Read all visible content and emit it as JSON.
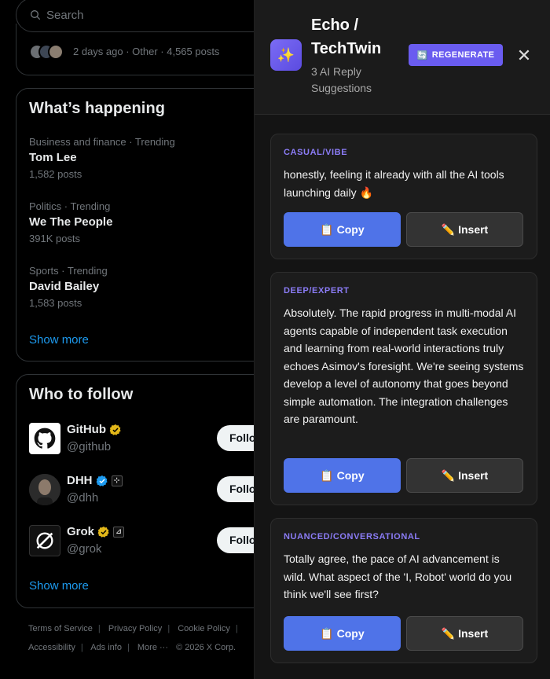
{
  "search": {
    "placeholder": "Search"
  },
  "news": {
    "meta": "2 days ago · Other · 4,565 posts"
  },
  "happening": {
    "title": "What’s happening",
    "trends": [
      {
        "context": "Business and finance · Trending",
        "name": "Tom Lee",
        "count": "1,582 posts"
      },
      {
        "context": "Politics · Trending",
        "name": "We The People",
        "count": "391K posts"
      },
      {
        "context": "Sports · Trending",
        "name": "David Bailey",
        "count": "1,583 posts"
      }
    ],
    "show_more": "Show more"
  },
  "who_to_follow": {
    "title": "Who to follow",
    "accounts": [
      {
        "name": "GitHub",
        "handle": "@github",
        "badge": "gold-check",
        "button": "Follow"
      },
      {
        "name": "DHH",
        "handle": "@dhh",
        "badge": "blue-check",
        "button": "Follow"
      },
      {
        "name": "Grok",
        "handle": "@grok",
        "badge": "gold-check",
        "button": "Follow"
      }
    ],
    "show_more": "Show more"
  },
  "footer": {
    "links_row1": [
      "Terms of Service",
      "Privacy Policy",
      "Cookie Policy"
    ],
    "links_row2": [
      "Accessibility",
      "Ads info",
      "More ···"
    ],
    "copyright": "© 2026 X Corp."
  },
  "panel": {
    "title": "Echo / TechTwin",
    "subtitle": "3 AI Reply Suggestions",
    "regenerate_label": "REGENERATE",
    "regenerate_icon": "🔄",
    "close_icon": "✕",
    "logo_icon": "✨",
    "accent": "#6a5cf0",
    "copy_color": "#4f73e8",
    "suggestions": [
      {
        "tag": "CASUAL/VIBE",
        "text": "honestly, feeling it already with all the AI tools launching daily 🔥",
        "copy_label": "📋 Copy",
        "insert_label": "✏️ Insert"
      },
      {
        "tag": "DEEP/EXPERT",
        "text": "Absolutely. The rapid progress in multi-modal AI agents capable of independent task execution and learning from real-world interactions truly echoes Asimov's foresight. We're seeing systems develop a level of autonomy that goes beyond simple automation. The integration challenges are paramount.",
        "copy_label": "📋 Copy",
        "insert_label": "✏️ Insert"
      },
      {
        "tag": "NUANCED/CONVERSATIONAL",
        "text": "Totally agree, the pace of AI advancement is wild. What aspect of the 'I, Robot' world do you think we'll see first?",
        "copy_label": "📋 Copy",
        "insert_label": "✏️ Insert"
      }
    ]
  }
}
